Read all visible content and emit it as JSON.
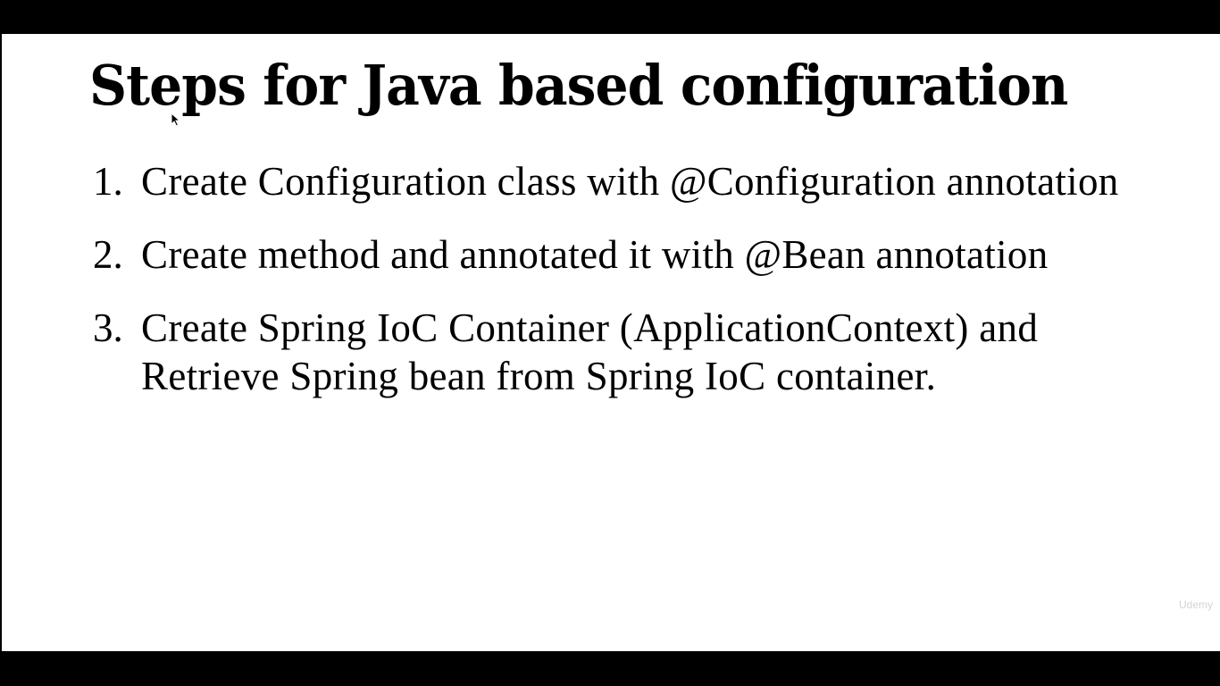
{
  "slide": {
    "title": "Steps for Java based configuration",
    "steps": [
      {
        "number": "1.",
        "text": "Create Configuration class with @Configuration annotation"
      },
      {
        "number": "2.",
        "text": "Create method and annotated it with @Bean annotation"
      },
      {
        "number": "3.",
        "text": "Create Spring IoC Container (ApplicationContext) and Retrieve Spring bean from Spring IoC container."
      }
    ],
    "watermark": "Udemy"
  },
  "colors": {
    "background": "#ffffff",
    "text": "#000000",
    "letterbox": "#000000",
    "watermark": "#d4d4d4"
  },
  "icons": {
    "cursor": "mouse-pointer-icon"
  }
}
